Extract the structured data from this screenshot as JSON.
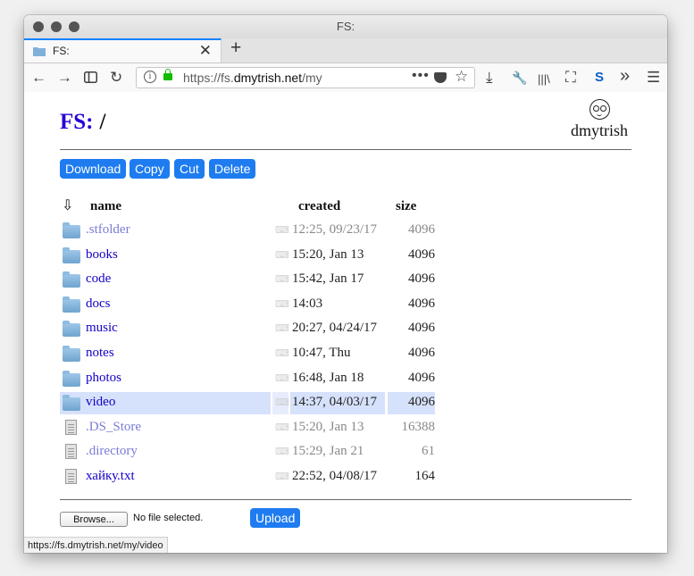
{
  "window": {
    "title": "FS:"
  },
  "tab": {
    "title": "FS:",
    "close": "✕",
    "new_tab": "+"
  },
  "nav": {
    "back": "←",
    "forward": "→",
    "reload": "↻",
    "url_prefix": "https://fs.",
    "url_domain": "dmytrish.net",
    "url_path": "/my",
    "page_actions": "•••",
    "bookmark_star": "☆",
    "download": "⤓",
    "tools": "🔧",
    "library": "|||\\",
    "screenshot": "⛶",
    "s_icon": "S",
    "overflow": "»",
    "menu": "☰"
  },
  "page": {
    "brand": "FS:",
    "path": "/",
    "logo_name": "dmytrish",
    "actions": [
      "Download",
      "Copy",
      "Cut",
      "Delete"
    ],
    "columns": {
      "download_icon": "⇩",
      "name": "name",
      "created": "created",
      "size": "size"
    },
    "files": [
      {
        "name": ".stfolder",
        "date": "12:25, 09/23/17",
        "size": "4096",
        "type": "folder",
        "dim": true,
        "selected": false
      },
      {
        "name": "books",
        "date": "15:20, Jan 13",
        "size": "4096",
        "type": "folder",
        "dim": false,
        "selected": false
      },
      {
        "name": "code",
        "date": "15:42, Jan 17",
        "size": "4096",
        "type": "folder",
        "dim": false,
        "selected": false
      },
      {
        "name": "docs",
        "date": "14:03",
        "size": "4096",
        "type": "folder",
        "dim": false,
        "selected": false
      },
      {
        "name": "music",
        "date": "20:27, 04/24/17",
        "size": "4096",
        "type": "folder",
        "dim": false,
        "selected": false
      },
      {
        "name": "notes",
        "date": "10:47, Thu",
        "size": "4096",
        "type": "folder",
        "dim": false,
        "selected": false
      },
      {
        "name": "photos",
        "date": "16:48, Jan 18",
        "size": "4096",
        "type": "folder",
        "dim": false,
        "selected": false
      },
      {
        "name": "video",
        "date": "14:37, 04/03/17",
        "size": "4096",
        "type": "folder",
        "dim": false,
        "selected": true
      },
      {
        "name": ".DS_Store",
        "date": "15:20, Jan 13",
        "size": "16388",
        "type": "file",
        "dim": true,
        "selected": false
      },
      {
        "name": ".directory",
        "date": "15:29, Jan 21",
        "size": "61",
        "type": "file",
        "dim": true,
        "selected": false
      },
      {
        "name": "хайку.txt",
        "date": "22:52, 04/08/17",
        "size": "164",
        "type": "file",
        "dim": false,
        "selected": false
      }
    ],
    "edit_icon": "⌨",
    "browse_label": "Browse...",
    "no_file": "No file selected.",
    "upload_label": "Upload"
  },
  "status_url": "https://fs.dmytrish.net/my/video",
  "colors": {
    "accent": "#1e7cf0",
    "link": "#1400c8",
    "brand": "#2300d8",
    "selection": "#d6e1fb"
  }
}
